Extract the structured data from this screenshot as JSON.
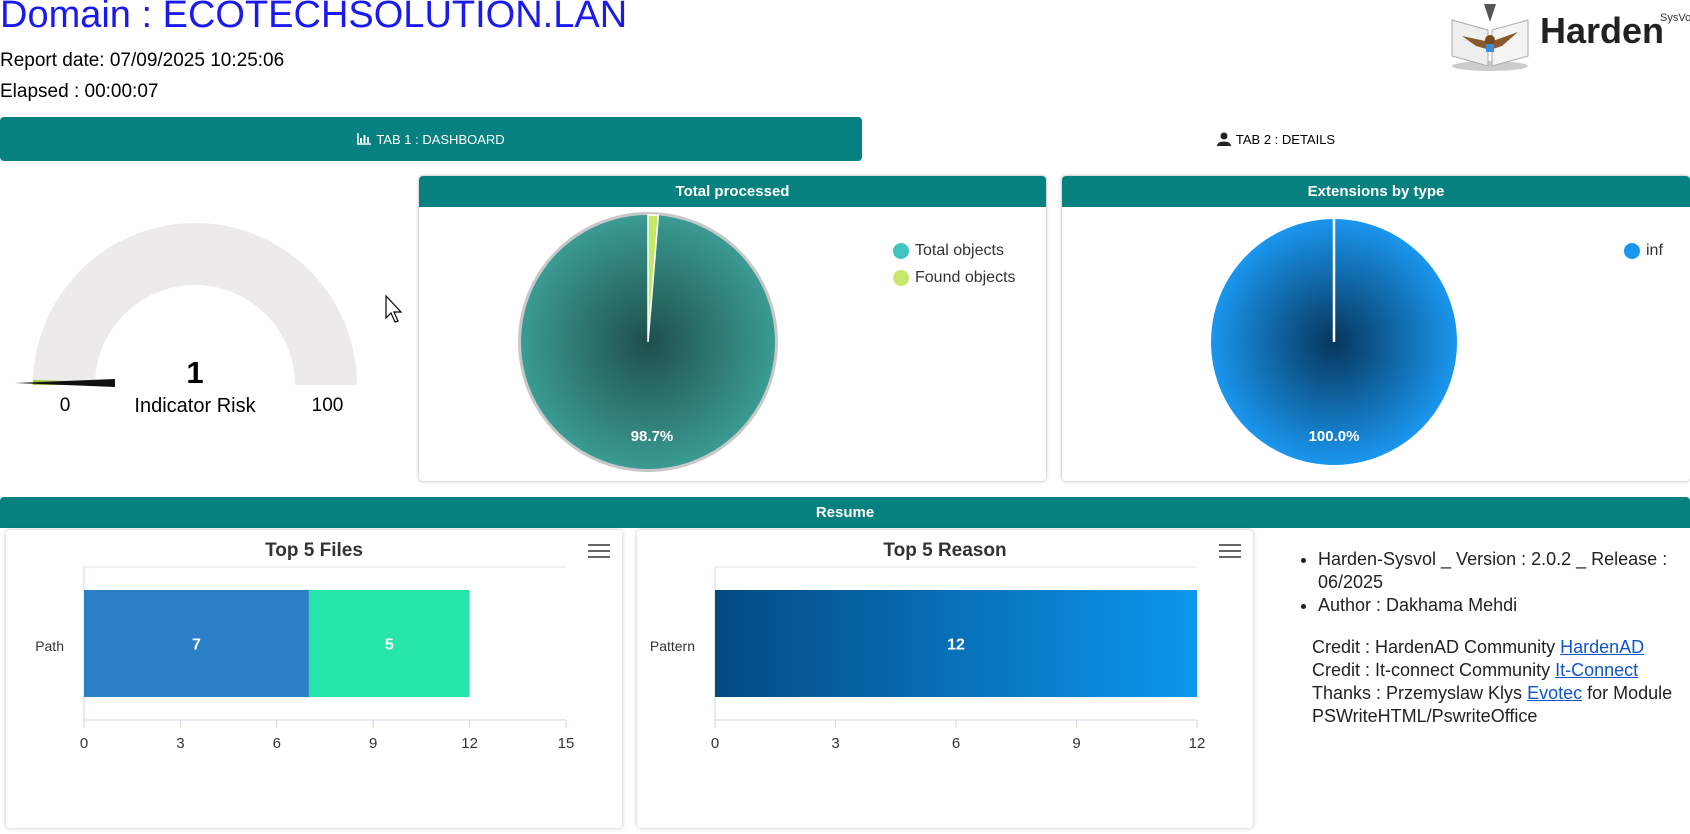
{
  "header": {
    "domain_title": "Domain : ECOTECHSOLUTION.LAN",
    "report_date": "Report date: 07/09/2025 10:25:06",
    "elapsed": "Elapsed : 00:00:07",
    "logo_text": "Harden",
    "logo_sup": "SysVo"
  },
  "tabs": {
    "dashboard": "TAB 1 : DASHBOARD",
    "details": "TAB 2 : DETAILS",
    "dashboard_icon": "bar-chart-icon",
    "details_icon": "user-icon"
  },
  "gauge": {
    "value": "1",
    "caption": "Indicator Risk",
    "min": "0",
    "max": "100",
    "level": 1
  },
  "panels": {
    "total_processed": "Total processed",
    "extensions_by_type": "Extensions by type",
    "resume": "Resume"
  },
  "chart_data": [
    {
      "type": "pie",
      "title": "Total processed",
      "labels": [
        "Total objects",
        "Found objects"
      ],
      "values": [
        98.7,
        1.3
      ],
      "colors": [
        "#3a9b92",
        "#c5e86c"
      ],
      "data_label": "98.7%",
      "legend": "top-right"
    },
    {
      "type": "pie",
      "title": "Extensions by type",
      "labels": [
        "inf"
      ],
      "values": [
        100
      ],
      "colors": [
        "#1a96ee"
      ],
      "data_label": "100.0%",
      "legend": "top-right"
    },
    {
      "type": "bar",
      "orientation": "horizontal",
      "stacked": true,
      "title": "Top 5 Files",
      "categories": [
        "Path"
      ],
      "series": [
        {
          "values": [
            7
          ],
          "color": "#2a7fc7"
        },
        {
          "values": [
            5
          ],
          "color": "#25e6a8"
        }
      ],
      "xticks": [
        "0",
        "3",
        "6",
        "9",
        "12",
        "15"
      ],
      "xlim": [
        0,
        15
      ]
    },
    {
      "type": "bar",
      "orientation": "horizontal",
      "title": "Top 5 Reason",
      "categories": [
        "Pattern"
      ],
      "series": [
        {
          "values": [
            12
          ],
          "color": "#0a6fc4"
        }
      ],
      "xticks": [
        "0",
        "3",
        "6",
        "9",
        "12"
      ],
      "xlim": [
        0,
        12
      ]
    }
  ],
  "info": {
    "bullet1": "Harden-Sysvol _ Version : 2.0.2 _ Release : 06/2025",
    "bullet2": "Author : Dakhama Mehdi",
    "credit1_text": "Credit : HardenAD Community ",
    "credit1_link": "HardenAD",
    "credit2_text": "Credit : It-connect Community ",
    "credit2_link": "It-Connect",
    "thanks_text": "Thanks : Przemyslaw Klys ",
    "thanks_link": "Evotec",
    "thanks_tail": " for Module PSWriteHTML/PswriteOffice"
  }
}
